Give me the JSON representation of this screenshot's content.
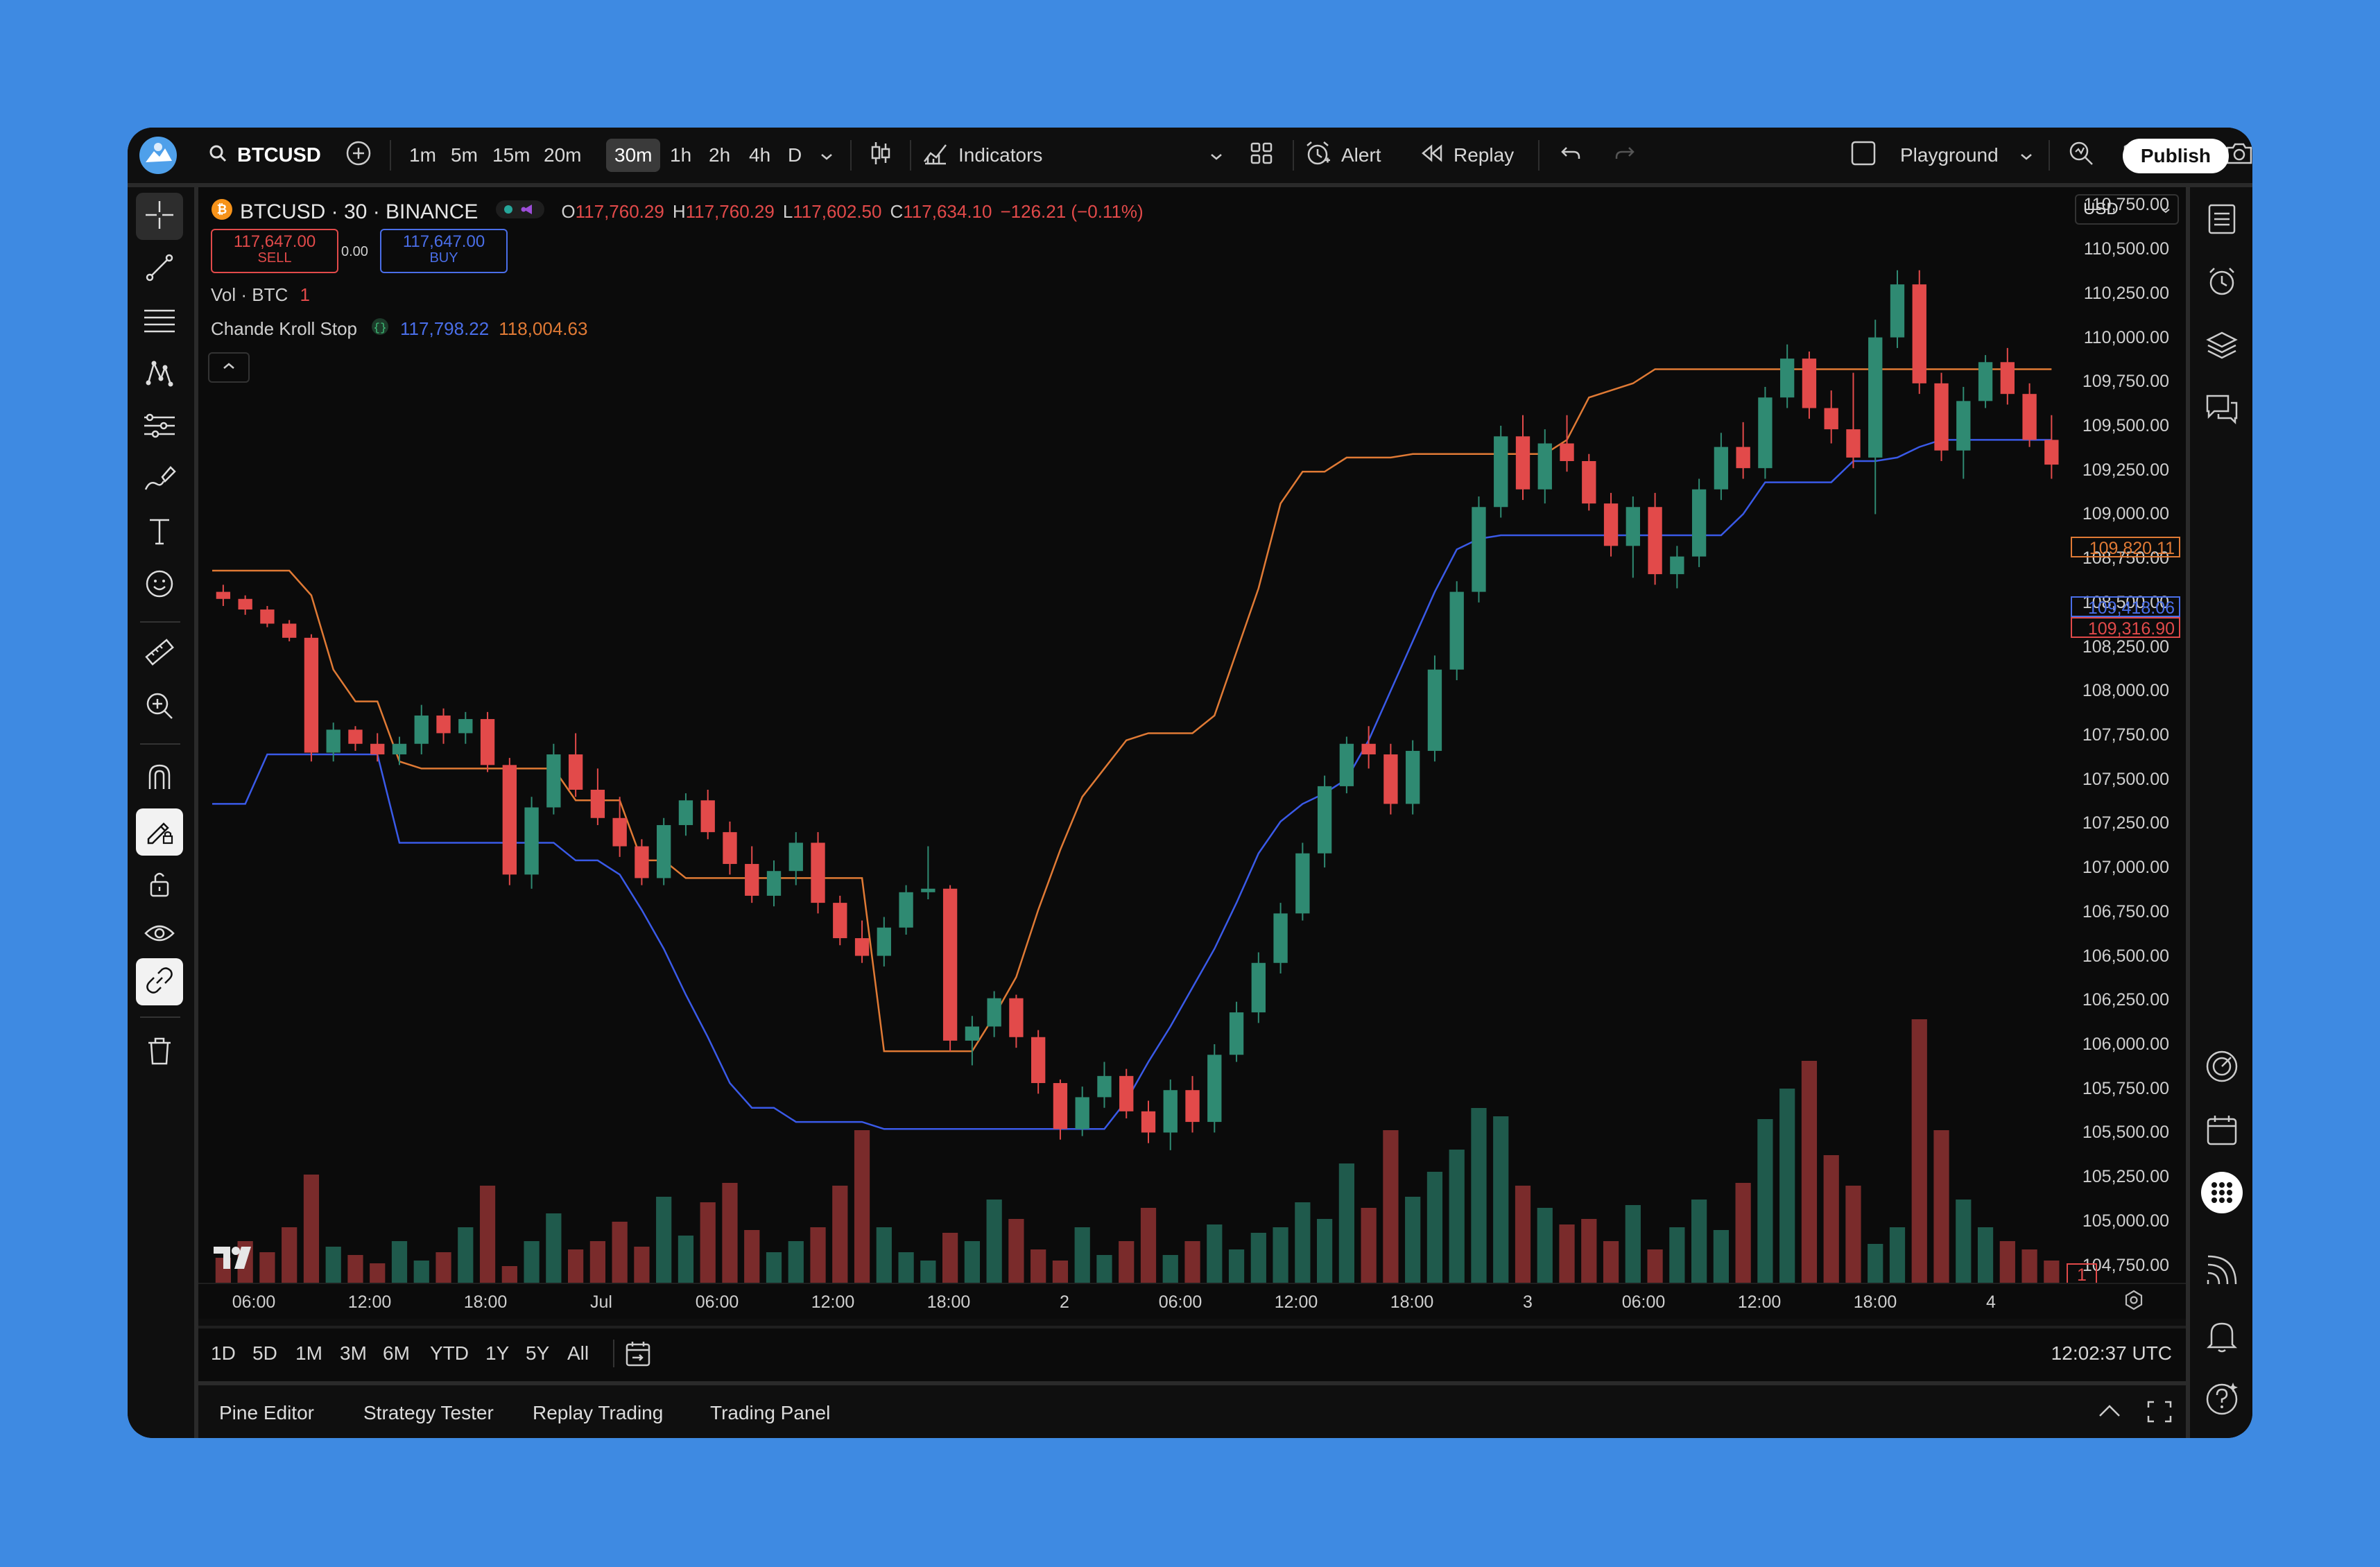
{
  "topbar": {
    "symbol": "BTCUSD",
    "intervals": [
      "1m",
      "5m",
      "15m",
      "20m",
      "30m",
      "1h",
      "2h",
      "4h",
      "D"
    ],
    "active_interval": "30m",
    "indicators_label": "Indicators",
    "alert_label": "Alert",
    "replay_label": "Replay",
    "layout_name": "Playground",
    "publish_label": "Publish"
  },
  "legend": {
    "title": "BTCUSD · 30 · BINANCE",
    "o_label": "O",
    "o": "117,760.29",
    "h_label": "H",
    "h": "117,760.29",
    "l_label": "L",
    "l": "117,602.50",
    "c_label": "C",
    "c": "117,634.10",
    "change": "−126.21 (−0.11%)",
    "sell_price": "117,647.00",
    "sell_label": "SELL",
    "spread": "0.00",
    "buy_price": "117,647.00",
    "buy_label": "BUY",
    "vol_label": "Vol · BTC",
    "vol_value": "1",
    "indicator_name": "Chande Kroll Stop",
    "ind_val1": "117,798.22",
    "ind_val2": "118,004.63",
    "currency": "USD"
  },
  "chart_data": {
    "type": "candlestick",
    "y_ticks": [
      "110,750.00",
      "110,500.00",
      "110,250.00",
      "110,000.00",
      "109,750.00",
      "109,500.00",
      "109,250.00",
      "109,000.00",
      "108,750.00",
      "108,500.00",
      "108,250.00",
      "108,000.00",
      "107,750.00",
      "107,500.00",
      "107,250.00",
      "107,000.00",
      "106,750.00",
      "106,500.00",
      "106,250.00",
      "106,000.00",
      "105,750.00",
      "105,500.00",
      "105,250.00",
      "105,000.00",
      "104,750.00"
    ],
    "x_ticks": [
      "06:00",
      "12:00",
      "18:00",
      "Jul",
      "06:00",
      "12:00",
      "18:00",
      "2",
      "06:00",
      "12:00",
      "18:00",
      "3",
      "06:00",
      "12:00",
      "18:00",
      "4"
    ],
    "price_labels": {
      "stop_orange": "109,820.11",
      "stop_blue": "109,418.06",
      "last": "109,316.90",
      "volume": "1"
    },
    "candles": [
      [
        108560,
        108600,
        108480,
        108520
      ],
      [
        108520,
        108540,
        108430,
        108460
      ],
      [
        108460,
        108480,
        108360,
        108380
      ],
      [
        108380,
        108400,
        108280,
        108300
      ],
      [
        108300,
        108320,
        107600,
        107650
      ],
      [
        107650,
        107820,
        107600,
        107780
      ],
      [
        107780,
        107800,
        107660,
        107700
      ],
      [
        107700,
        107760,
        107600,
        107640
      ],
      [
        107640,
        107740,
        107580,
        107700
      ],
      [
        107700,
        107920,
        107640,
        107860
      ],
      [
        107860,
        107900,
        107700,
        107760
      ],
      [
        107760,
        107880,
        107700,
        107840
      ],
      [
        107840,
        107880,
        107540,
        107580
      ],
      [
        107580,
        107620,
        106900,
        106960
      ],
      [
        106960,
        107400,
        106880,
        107340
      ],
      [
        107340,
        107700,
        107300,
        107640
      ],
      [
        107640,
        107760,
        107400,
        107440
      ],
      [
        107440,
        107560,
        107240,
        107280
      ],
      [
        107280,
        107400,
        107060,
        107120
      ],
      [
        107120,
        107160,
        106900,
        106940
      ],
      [
        106940,
        107280,
        106900,
        107240
      ],
      [
        107240,
        107420,
        107180,
        107380
      ],
      [
        107380,
        107440,
        107160,
        107200
      ],
      [
        107200,
        107260,
        106960,
        107020
      ],
      [
        107020,
        107120,
        106800,
        106840
      ],
      [
        106840,
        107040,
        106780,
        106980
      ],
      [
        106980,
        107200,
        106900,
        107140
      ],
      [
        107140,
        107200,
        106740,
        106800
      ],
      [
        106800,
        106840,
        106560,
        106600
      ],
      [
        106600,
        106700,
        106460,
        106500
      ],
      [
        106500,
        106720,
        106440,
        106660
      ],
      [
        106660,
        106900,
        106620,
        106860
      ],
      [
        106860,
        107120,
        106820,
        106880
      ],
      [
        106880,
        106900,
        105960,
        106020
      ],
      [
        106020,
        106160,
        105880,
        106100
      ],
      [
        106100,
        106300,
        106040,
        106260
      ],
      [
        106260,
        106280,
        105980,
        106040
      ],
      [
        106040,
        106080,
        105720,
        105780
      ],
      [
        105780,
        105800,
        105460,
        105520
      ],
      [
        105520,
        105760,
        105480,
        105700
      ],
      [
        105700,
        105900,
        105640,
        105820
      ],
      [
        105820,
        105860,
        105580,
        105620
      ],
      [
        105620,
        105680,
        105440,
        105500
      ],
      [
        105500,
        105800,
        105400,
        105740
      ],
      [
        105740,
        105820,
        105500,
        105560
      ],
      [
        105560,
        106000,
        105500,
        105940
      ],
      [
        105940,
        106240,
        105900,
        106180
      ],
      [
        106180,
        106520,
        106120,
        106460
      ],
      [
        106460,
        106800,
        106400,
        106740
      ],
      [
        106740,
        107140,
        106700,
        107080
      ],
      [
        107080,
        107520,
        107000,
        107460
      ],
      [
        107460,
        107740,
        107420,
        107700
      ],
      [
        107700,
        107800,
        107560,
        107640
      ],
      [
        107640,
        107700,
        107300,
        107360
      ],
      [
        107360,
        107720,
        107300,
        107660
      ],
      [
        107660,
        108200,
        107600,
        108120
      ],
      [
        108120,
        108620,
        108060,
        108560
      ],
      [
        108560,
        109100,
        108500,
        109040
      ],
      [
        109040,
        109500,
        108980,
        109440
      ],
      [
        109440,
        109560,
        109080,
        109140
      ],
      [
        109140,
        109480,
        109060,
        109400
      ],
      [
        109400,
        109560,
        109240,
        109300
      ],
      [
        109300,
        109340,
        109020,
        109060
      ],
      [
        109060,
        109120,
        108760,
        108820
      ],
      [
        108820,
        109100,
        108640,
        109040
      ],
      [
        109040,
        109120,
        108600,
        108660
      ],
      [
        108660,
        108820,
        108580,
        108760
      ],
      [
        108760,
        109200,
        108700,
        109140
      ],
      [
        109140,
        109460,
        109080,
        109380
      ],
      [
        109380,
        109520,
        109200,
        109260
      ],
      [
        109260,
        109720,
        109200,
        109660
      ],
      [
        109660,
        109960,
        109600,
        109880
      ],
      [
        109880,
        109920,
        109540,
        109600
      ],
      [
        109600,
        109700,
        109400,
        109480
      ],
      [
        109480,
        109800,
        109260,
        109320
      ],
      [
        109320,
        110100,
        109000,
        110000
      ],
      [
        110000,
        110380,
        109940,
        110300
      ],
      [
        110300,
        110380,
        109680,
        109740
      ],
      [
        109740,
        109800,
        109300,
        109360
      ],
      [
        109360,
        109720,
        109200,
        109640
      ],
      [
        109640,
        109900,
        109600,
        109860
      ],
      [
        109860,
        109940,
        109620,
        109680
      ],
      [
        109680,
        109740,
        109380,
        109420
      ],
      [
        109420,
        109560,
        109200,
        109280
      ]
    ],
    "volume": [
      18,
      30,
      22,
      40,
      78,
      26,
      20,
      14,
      30,
      16,
      22,
      40,
      70,
      12,
      30,
      50,
      24,
      30,
      44,
      26,
      62,
      34,
      58,
      72,
      38,
      22,
      30,
      40,
      70,
      110,
      40,
      22,
      16,
      36,
      30,
      60,
      46,
      24,
      16,
      40,
      20,
      30,
      54,
      20,
      30,
      42,
      24,
      36,
      40,
      58,
      46,
      86,
      54,
      110,
      62,
      80,
      96,
      126,
      120,
      70,
      54,
      42,
      46,
      30,
      56,
      24,
      40,
      60,
      38,
      72,
      118,
      140,
      160,
      92,
      70,
      28,
      40,
      190,
      110,
      60,
      40,
      30,
      24,
      16,
      20,
      14
    ],
    "cks_orange": [
      108680,
      108680,
      108680,
      108680,
      108540,
      108120,
      107940,
      107940,
      107600,
      107560,
      107560,
      107560,
      107560,
      107560,
      107560,
      107560,
      107380,
      107380,
      107380,
      107040,
      107040,
      106940,
      106940,
      106940,
      106940,
      106940,
      106940,
      106940,
      106940,
      106940,
      105960,
      105960,
      105960,
      105960,
      105960,
      106160,
      106380,
      106760,
      107100,
      107400,
      107560,
      107720,
      107760,
      107760,
      107760,
      107860,
      108220,
      108580,
      109060,
      109240,
      109240,
      109320,
      109320,
      109320,
      109340,
      109340,
      109340,
      109340,
      109340,
      109340,
      109340,
      109420,
      109660,
      109700,
      109740,
      109820,
      109820,
      109820,
      109820,
      109820,
      109820,
      109820,
      109820,
      109820,
      109820,
      109820,
      109820,
      109820,
      109820,
      109820,
      109820,
      109820,
      109820,
      109820,
      109820,
      109820
    ],
    "cks_blue": [
      107360,
      107360,
      107640,
      107640,
      107640,
      107640,
      107640,
      107640,
      107140,
      107140,
      107140,
      107140,
      107140,
      107140,
      107140,
      107140,
      107040,
      107040,
      106960,
      106760,
      106540,
      106280,
      106040,
      105780,
      105640,
      105640,
      105560,
      105560,
      105560,
      105560,
      105520,
      105520,
      105520,
      105520,
      105520,
      105520,
      105520,
      105520,
      105520,
      105520,
      105520,
      105680,
      105900,
      106100,
      106320,
      106540,
      106800,
      107080,
      107260,
      107360,
      107420,
      107500,
      107720,
      108000,
      108280,
      108560,
      108800,
      108860,
      108880,
      108880,
      108880,
      108880,
      108880,
      108880,
      108880,
      108880,
      108880,
      108880,
      108880,
      109000,
      109180,
      109180,
      109180,
      109180,
      109300,
      109300,
      109320,
      109380,
      109420,
      109420,
      109420,
      109420,
      109420,
      109420,
      109420,
      109420
    ]
  },
  "rangebar": {
    "ranges": [
      "1D",
      "5D",
      "1M",
      "3M",
      "6M",
      "YTD",
      "1Y",
      "5Y",
      "All"
    ],
    "clock": "12:02:37 UTC"
  },
  "bottom_panel": {
    "tabs": [
      "Pine Editor",
      "Strategy Tester",
      "Replay Trading",
      "Trading Panel"
    ]
  },
  "colors": {
    "up": "#2f8a72",
    "down": "#e24a4a",
    "cks_orange": "#e07a35",
    "cks_blue": "#3a5ae8",
    "background": "#3e8ae2"
  }
}
